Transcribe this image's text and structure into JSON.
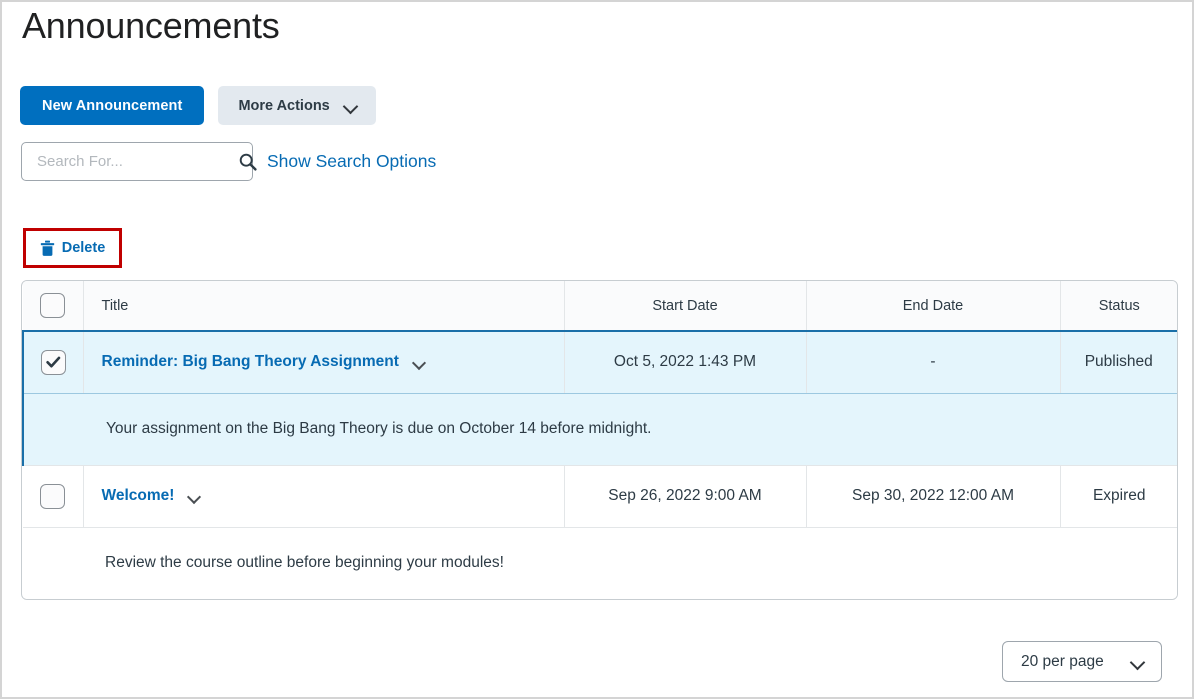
{
  "page": {
    "title": "Announcements"
  },
  "toolbar": {
    "new_announcement_label": "New Announcement",
    "more_actions_label": "More Actions"
  },
  "search": {
    "value": "",
    "placeholder": "Search For...",
    "show_options_label": "Show Search Options"
  },
  "actions": {
    "delete_label": "Delete"
  },
  "table": {
    "columns": [
      "",
      "Title",
      "Start Date",
      "End Date",
      "Status"
    ],
    "rows": [
      {
        "checked": "true",
        "title": "Reminder: Big Bang Theory Assignment",
        "start_date": "Oct 5, 2022 1:43 PM",
        "end_date": "-",
        "status": "Published",
        "body": "Your assignment on the Big Bang Theory is due on October 14 before midnight."
      },
      {
        "checked": "false",
        "title": "Welcome!",
        "start_date": "Sep 26, 2022 9:00 AM",
        "end_date": "Sep 30, 2022 12:00 AM",
        "status": "Expired",
        "body": "Review the course outline before beginning your modules!"
      }
    ]
  },
  "pagination": {
    "per_page_label": "20 per page"
  },
  "colors": {
    "primary_blue": "#006fbf",
    "link_blue": "#076bb3",
    "selected_row_bg": "#e4f5fc",
    "selected_row_border": "#1a6fa8",
    "annotation_red": "#c00000",
    "secondary_button_bg": "#e3e9ef"
  },
  "icons": {
    "search": "search-icon",
    "trash": "trash-icon",
    "chevron_down": "chevron-down-icon",
    "checkmark": "checkmark-icon"
  }
}
